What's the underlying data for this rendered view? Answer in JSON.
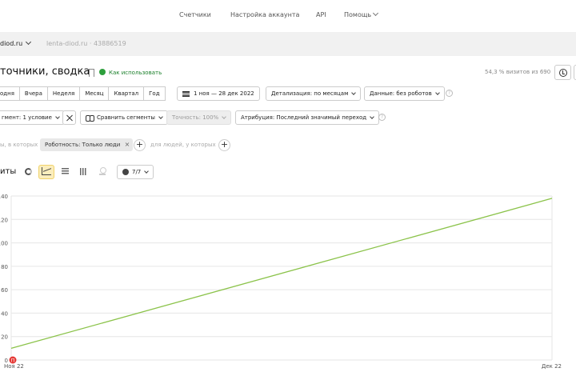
{
  "topnav": {
    "items": [
      {
        "label": "Счетчики"
      },
      {
        "label": "Настройка аккаунта"
      },
      {
        "label": "API"
      },
      {
        "label": "Помощь"
      }
    ]
  },
  "sitebar": {
    "site": "diod.ru",
    "counter": "lenta-diod.ru · 43886519"
  },
  "report": {
    "title": "точники, сводка",
    "howto": "Как использовать",
    "visits_share": "54,3 % визитов из 690"
  },
  "period": {
    "segments": [
      "одня",
      "Вчера",
      "Неделя",
      "Месяц",
      "Квартал",
      "Год"
    ],
    "date_range": "1 ноя — 28 дек 2022",
    "detail": "Детализация: по месяцам",
    "data_filter": "Данные: без роботов"
  },
  "segment_row": {
    "segment": "гмент: 1 условие",
    "compare": "Сравнить сегменты",
    "accuracy": "Точность: 100%",
    "attribution": "Атрибуция: Последний значимый переход"
  },
  "filters": {
    "prefix": "ы, в которых",
    "tag": "Роботность: Только люди",
    "suffix": "для людей, у которых"
  },
  "chart_toolbar": {
    "title": "иты",
    "series_count": "7/7"
  },
  "chart_data": {
    "type": "line",
    "title": "",
    "x": [
      "Ноя 22",
      "Дек 22"
    ],
    "series": [
      {
        "name": "",
        "values": [
          10,
          138
        ],
        "color": "#8bc34a"
      }
    ],
    "ylabels": [
      "0",
      "20",
      "40",
      "60",
      "80",
      "100",
      "120",
      "140"
    ],
    "xlabels": [
      "Ноя 22",
      "Дек 22"
    ],
    "ylim": [
      0,
      140
    ],
    "grid": true,
    "annotation": {
      "x": "Ноя 22",
      "label": "П",
      "color": "#e53935"
    }
  }
}
